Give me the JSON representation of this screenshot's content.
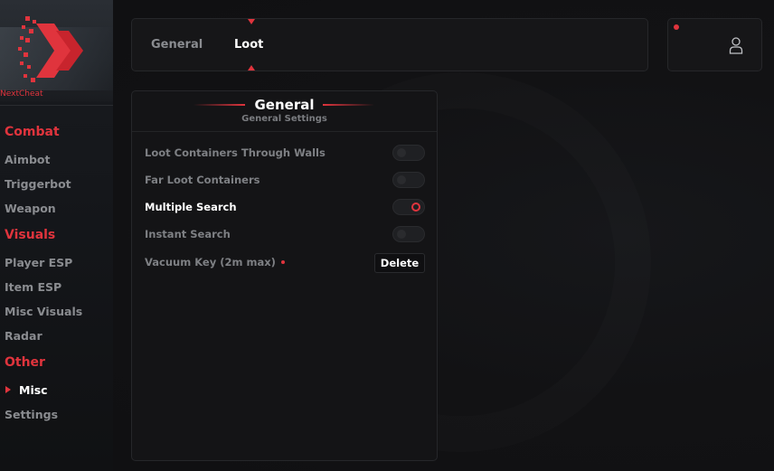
{
  "brand": {
    "name": "NextCheat"
  },
  "sidebar": {
    "categories": [
      {
        "label": "Combat",
        "items": [
          "Aimbot",
          "Triggerbot",
          "Weapon"
        ]
      },
      {
        "label": "Visuals",
        "items": [
          "Player ESP",
          "Item ESP",
          "Misc Visuals",
          "Radar"
        ]
      },
      {
        "label": "Other",
        "items": [
          "Misc",
          "Settings"
        ]
      }
    ],
    "active_item": "Misc"
  },
  "tabs": [
    {
      "label": "General",
      "active": false
    },
    {
      "label": "Loot",
      "active": true
    }
  ],
  "panel": {
    "title": "General",
    "subtitle": "General Settings",
    "options": [
      {
        "label": "Loot Containers Through Walls",
        "type": "toggle",
        "enabled": false
      },
      {
        "label": "Far Loot Containers",
        "type": "toggle",
        "enabled": false
      },
      {
        "label": "Multiple Search",
        "type": "toggle",
        "enabled": true
      },
      {
        "label": "Instant Search",
        "type": "toggle",
        "enabled": false
      },
      {
        "label": "Vacuum Key (2m max)",
        "type": "keybind",
        "key": "Delete"
      }
    ]
  },
  "icons": {
    "user": "user-icon",
    "logo": "chevron-logo-icon",
    "active": "triangle-right-icon"
  },
  "colors": {
    "accent": "#e0343d",
    "background": "#111113",
    "panel": "#141416",
    "text_muted": "#8a8c90"
  }
}
